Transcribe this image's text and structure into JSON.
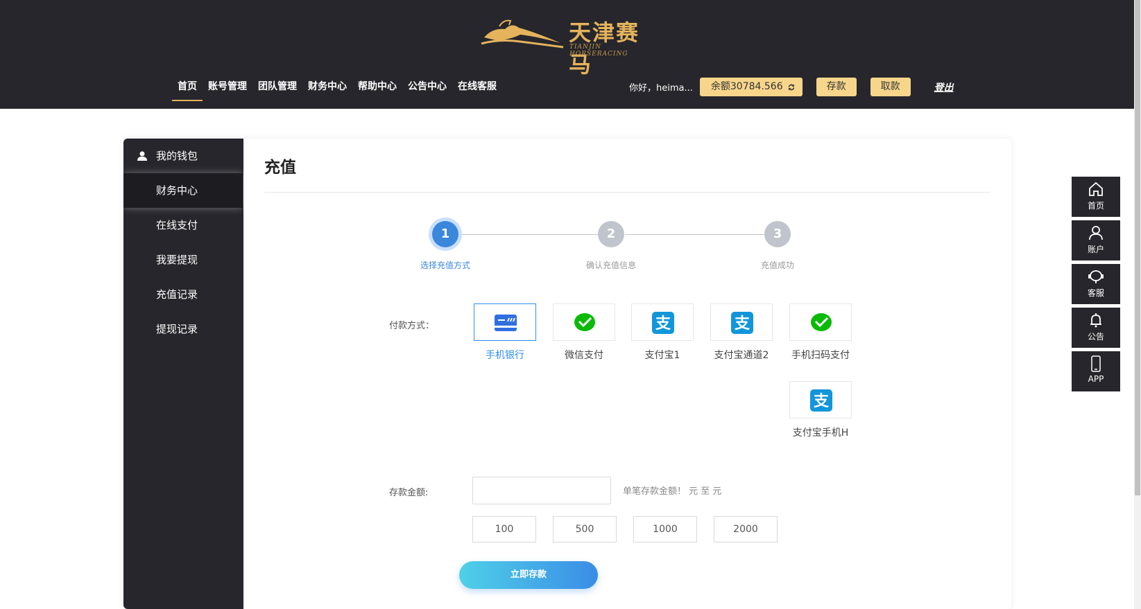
{
  "header": {
    "logo_text": "天津赛马",
    "logo_sub": "TIANJIN HORSERACING",
    "nav": [
      "首页",
      "账号管理",
      "团队管理",
      "财务中心",
      "帮助中心",
      "公告中心",
      "在线客服"
    ],
    "greeting": "你好，heima...",
    "balance": "余额30784.566",
    "deposit": "存款",
    "withdraw": "取款",
    "logout": "登出"
  },
  "sidebar": {
    "head": "我的钱包",
    "items": [
      "财务中心",
      "在线支付",
      "我要提现",
      "充值记录",
      "提现记录"
    ]
  },
  "main": {
    "title": "充值",
    "steps": [
      {
        "num": "1",
        "label": "选择充值方式"
      },
      {
        "num": "2",
        "label": "确认充值信息"
      },
      {
        "num": "3",
        "label": "充值成功"
      }
    ],
    "pay_label": "付款方式：",
    "pay_methods": [
      "手机银行",
      "微信支付",
      "支付宝1",
      "支付宝通道2",
      "手机扫码支付",
      "支付宝手机H"
    ],
    "amount_label": "存款金额:",
    "amount_value": "",
    "amount_hint": "单笔存款金额！ 元 至 元",
    "quick_amounts": [
      "100",
      "500",
      "1000",
      "2000"
    ],
    "submit": "立即存款"
  },
  "float_bar": [
    "首页",
    "账户",
    "客服",
    "公告",
    "APP"
  ],
  "colors": {
    "dark": "#26262c",
    "gold": "#f7d68b",
    "blue": "#2d8cf0"
  }
}
